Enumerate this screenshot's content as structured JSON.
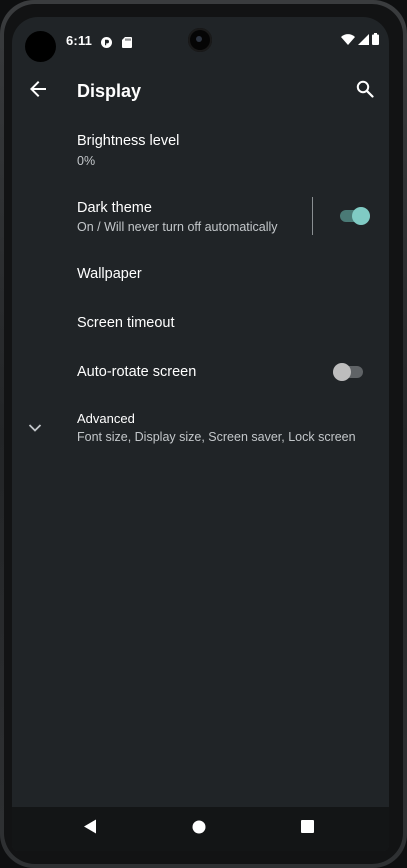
{
  "status_bar": {
    "time": "6:11",
    "icons": [
      "camera-cutout",
      "notification-p-icon",
      "sd-card-icon",
      "wifi-icon",
      "signal-icon",
      "battery-icon"
    ]
  },
  "app_bar": {
    "title": "Display",
    "back_icon": "arrow-left-icon",
    "search_icon": "search-icon"
  },
  "settings": {
    "brightness": {
      "title": "Brightness level",
      "summary": "0%"
    },
    "dark_theme": {
      "title": "Dark theme",
      "summary": "On / Will never turn off automatically",
      "checked": true
    },
    "wallpaper": {
      "title": "Wallpaper"
    },
    "screen_timeout": {
      "title": "Screen timeout"
    },
    "auto_rotate": {
      "title": "Auto-rotate screen",
      "checked": false
    },
    "advanced": {
      "title": "Advanced",
      "summary": "Font size, Display size, Screen saver, Lock screen",
      "icon": "chevron-down-icon"
    }
  },
  "nav_bar": {
    "back_icon": "nav-back-icon",
    "home_icon": "nav-home-icon",
    "recents_icon": "nav-recents-icon"
  },
  "colors": {
    "background": "#202427",
    "accent": "#80cbc4",
    "accent_track": "#4a7a76",
    "switch_off_thumb": "#bdbdbd",
    "switch_off_track": "#5f6366",
    "text_primary": "#ffffff",
    "text_secondary": "#c3c7ca"
  }
}
